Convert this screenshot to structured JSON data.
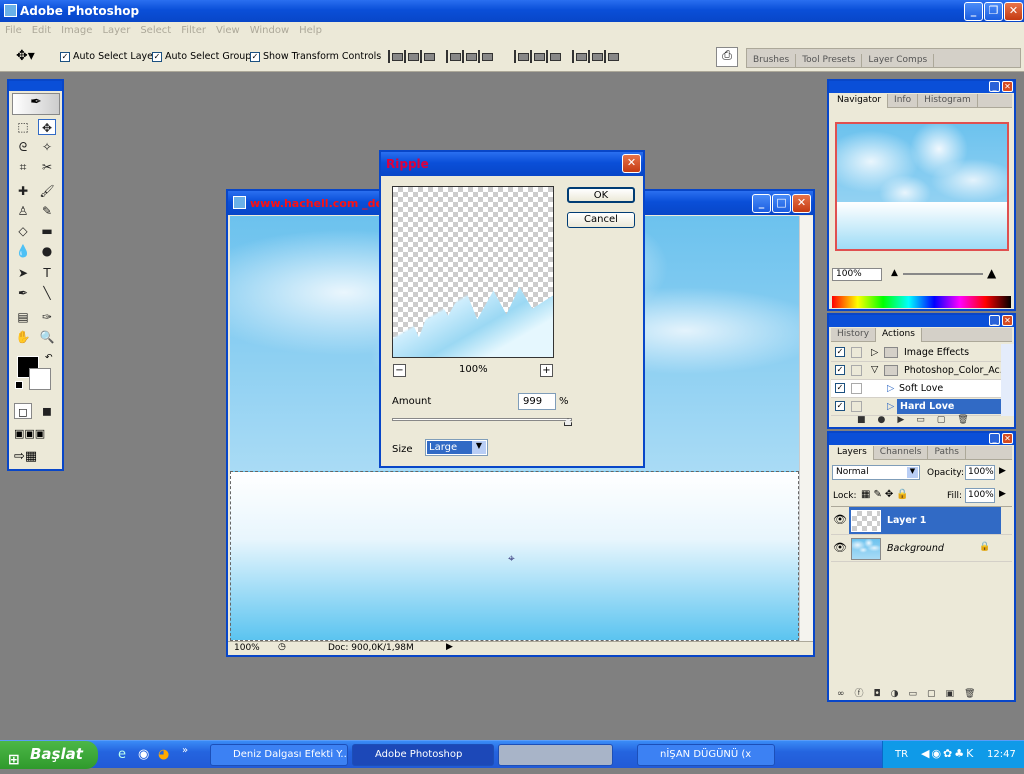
{
  "app": {
    "title": "Adobe Photoshop"
  },
  "menu": [
    "File",
    "Edit",
    "Image",
    "Layer",
    "Select",
    "Filter",
    "View",
    "Window",
    "Help"
  ],
  "options": {
    "auto_select_layer": "Auto Select Layer",
    "auto_select_groups": "Auto Select Groups",
    "show_transform": "Show Transform Controls"
  },
  "palette_well": [
    "Brushes",
    "Tool Presets",
    "Layer Comps"
  ],
  "document": {
    "title": "www.hachell.com _des",
    "zoom": "100%",
    "doc_info": "Doc: 900,0K/1,98M"
  },
  "dialog": {
    "title": "Ripple",
    "ok": "OK",
    "cancel": "Cancel",
    "preview_zoom": "100%",
    "zoom_out": "−",
    "zoom_in": "+",
    "amount_label": "Amount",
    "amount_value": "999",
    "amount_unit": "%",
    "amount_slider": 1.0,
    "size_label": "Size",
    "size_value": "Large"
  },
  "navigator": {
    "tabs": [
      "Navigator",
      "Info",
      "Histogram"
    ],
    "zoom": "100%"
  },
  "history": {
    "tabs": [
      "History",
      "Actions"
    ],
    "actions": [
      {
        "name": "Image Effects",
        "type": "folder",
        "indent": 0,
        "selected": false
      },
      {
        "name": "Photoshop_Color_Ac...",
        "type": "folder",
        "indent": 0,
        "selected": false
      },
      {
        "name": "Soft Love",
        "type": "action",
        "indent": 1,
        "selected": false
      },
      {
        "name": "Hard Love",
        "type": "action",
        "indent": 1,
        "selected": true
      }
    ]
  },
  "layers": {
    "tabs": [
      "Layers",
      "Channels",
      "Paths"
    ],
    "blend_mode": "Normal",
    "opacity_label": "Opacity:",
    "opacity": "100%",
    "lock_label": "Lock:",
    "fill_label": "Fill:",
    "fill": "100%",
    "items": [
      {
        "name": "Layer 1",
        "selected": true
      },
      {
        "name": "Background",
        "selected": false
      }
    ]
  },
  "taskbar": {
    "start": "Başlat",
    "tasks": [
      "Deniz Dalgası Efekti Y...",
      "Adobe Photoshop",
      "nİŞAN DÜGÜNÜ (x"
    ],
    "lang": "TR",
    "clock": "12:47"
  },
  "colors": {
    "xp_blue": "#0a4fd8",
    "selection": "#316ac5",
    "dialog_title": "#e0003c",
    "doc_title": "#ff1010"
  }
}
